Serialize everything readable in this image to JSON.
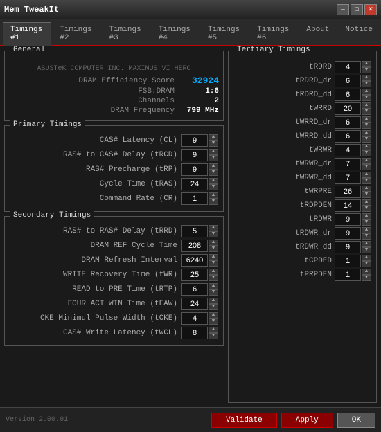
{
  "titlebar": {
    "title": "Mem TweakIt",
    "min_label": "—",
    "max_label": "□",
    "close_label": "✕"
  },
  "tabs": [
    {
      "label": "Timings #1",
      "active": true
    },
    {
      "label": "Timings #2",
      "active": false
    },
    {
      "label": "Timings #3",
      "active": false
    },
    {
      "label": "Timings #4",
      "active": false
    },
    {
      "label": "Timings #5",
      "active": false
    },
    {
      "label": "Timings #6",
      "active": false
    },
    {
      "label": "About",
      "active": false
    },
    {
      "label": "Notice",
      "active": false
    }
  ],
  "general": {
    "panel_title": "General",
    "mb_name": "ASUSTeK COMPUTER INC. MAXIMUS VI HERO",
    "dram_efficiency_label": "DRAM Efficiency Score",
    "dram_efficiency_value": "32924",
    "fsb_label": "FSB:DRAM",
    "fsb_value": "1:6",
    "channels_label": "Channels",
    "channels_value": "2",
    "freq_label": "DRAM Frequency",
    "freq_value": "799 MHz"
  },
  "primary": {
    "panel_title": "Primary Timings",
    "rows": [
      {
        "label": "CAS# Latency (CL)",
        "value": "9"
      },
      {
        "label": "RAS# to CAS# Delay (tRCD)",
        "value": "9"
      },
      {
        "label": "RAS# Precharge (tRP)",
        "value": "9"
      },
      {
        "label": "Cycle Time (tRAS)",
        "value": "24"
      },
      {
        "label": "Command Rate (CR)",
        "value": "1"
      }
    ]
  },
  "secondary": {
    "panel_title": "Secondary Timings",
    "rows": [
      {
        "label": "RAS# to RAS# Delay (tRRD)",
        "value": "5"
      },
      {
        "label": "DRAM REF Cycle Time",
        "value": "208"
      },
      {
        "label": "DRAM Refresh Interval",
        "value": "6240"
      },
      {
        "label": "WRITE Recovery Time (tWR)",
        "value": "25"
      },
      {
        "label": "READ to PRE Time (tRTP)",
        "value": "6"
      },
      {
        "label": "FOUR ACT WIN Time (tFAW)",
        "value": "24"
      },
      {
        "label": "CKE Minimul Pulse Width (tCKE)",
        "value": "4"
      },
      {
        "label": "CAS# Write Latency (tWCL)",
        "value": "8"
      }
    ]
  },
  "tertiary": {
    "panel_title": "Tertiary Timings",
    "rows": [
      {
        "label": "tRDRD",
        "value": "4"
      },
      {
        "label": "tRDRD_dr",
        "value": "6"
      },
      {
        "label": "tRDRD_dd",
        "value": "6"
      },
      {
        "label": "tWRRD",
        "value": "20"
      },
      {
        "label": "tWRRD_dr",
        "value": "6"
      },
      {
        "label": "tWRRD_dd",
        "value": "6"
      },
      {
        "label": "tWRWR",
        "value": "4"
      },
      {
        "label": "tWRWR_dr",
        "value": "7"
      },
      {
        "label": "tWRWR_dd",
        "value": "7"
      },
      {
        "label": "tWRPRE",
        "value": "26"
      },
      {
        "label": "tRDPDEN",
        "value": "14"
      },
      {
        "label": "tRDWR",
        "value": "9"
      },
      {
        "label": "tRDWR_dr",
        "value": "9"
      },
      {
        "label": "tRDWR_dd",
        "value": "9"
      },
      {
        "label": "tCPDED",
        "value": "1"
      },
      {
        "label": "tPRPDEN",
        "value": "1"
      }
    ]
  },
  "footer": {
    "version": "Version 2.00.01",
    "validate_label": "Validate",
    "apply_label": "Apply",
    "ok_label": "OK"
  }
}
